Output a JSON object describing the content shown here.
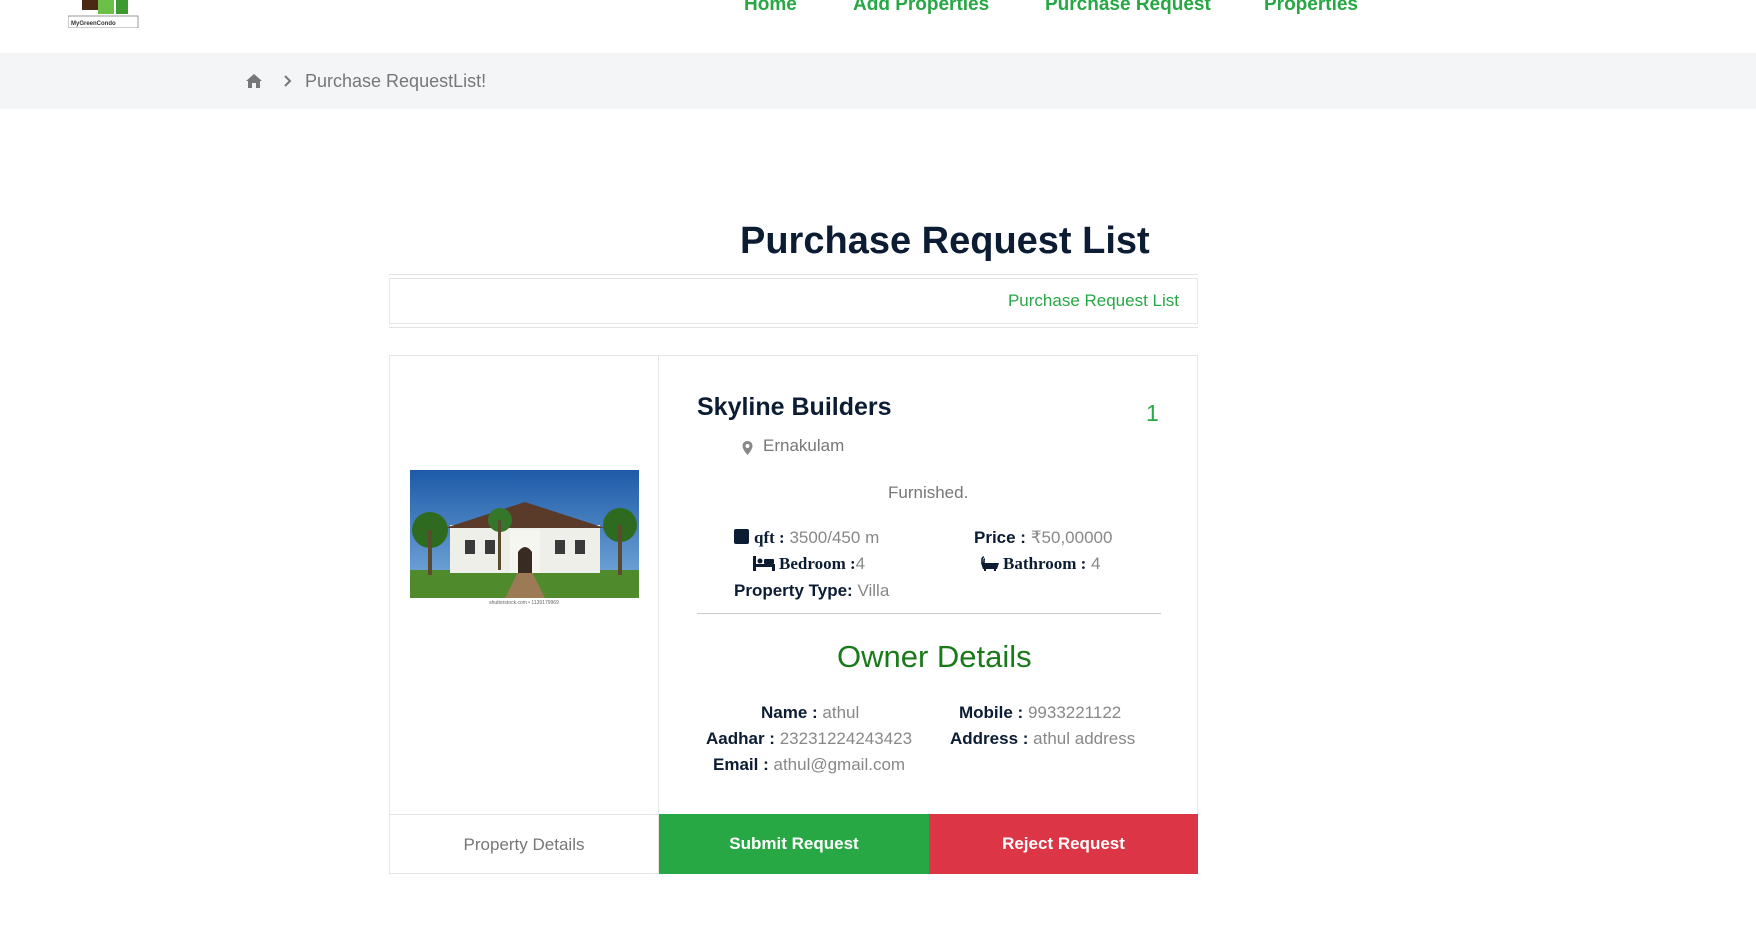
{
  "header": {
    "logo_text": "MyGreenCondo",
    "nav": [
      "Home",
      "Add Properties",
      "Purchase Request",
      "Properties"
    ]
  },
  "breadcrumb": {
    "current": "Purchase RequestList!"
  },
  "page": {
    "title": "Purchase Request List",
    "strip_label": "Purchase Request List"
  },
  "property": {
    "name": "Skyline Builders",
    "number": "1",
    "location": "Ernakulam",
    "furnishing": "Furnished.",
    "image_caption": "shutterstock.com • 1139179969",
    "qft_label": "qft :",
    "qft_value": "3500/450 m",
    "price_label": "Price :",
    "price_value": "₹50,00000",
    "bedroom_label": "Bedroom :",
    "bedroom_value": "4",
    "bathroom_label": "Bathroom :",
    "bathroom_value": "4",
    "type_label": "Property Type:",
    "type_value": "Villa"
  },
  "owner": {
    "title": "Owner Details",
    "name_label": "Name :",
    "name_value": "athul",
    "mobile_label": "Mobile :",
    "mobile_value": "9933221122",
    "aadhar_label": "Aadhar :",
    "aadhar_value": "23231224243423",
    "address_label": "Address :",
    "address_value": "athul address",
    "email_label": "Email :",
    "email_value": "athul@gmail.com"
  },
  "actions": {
    "details": "Property Details",
    "submit": "Submit Request",
    "reject": "Reject Request"
  },
  "colors": {
    "accent": "#28a745",
    "danger": "#dc3545",
    "heading": "#0b1c33",
    "muted": "#888888"
  }
}
